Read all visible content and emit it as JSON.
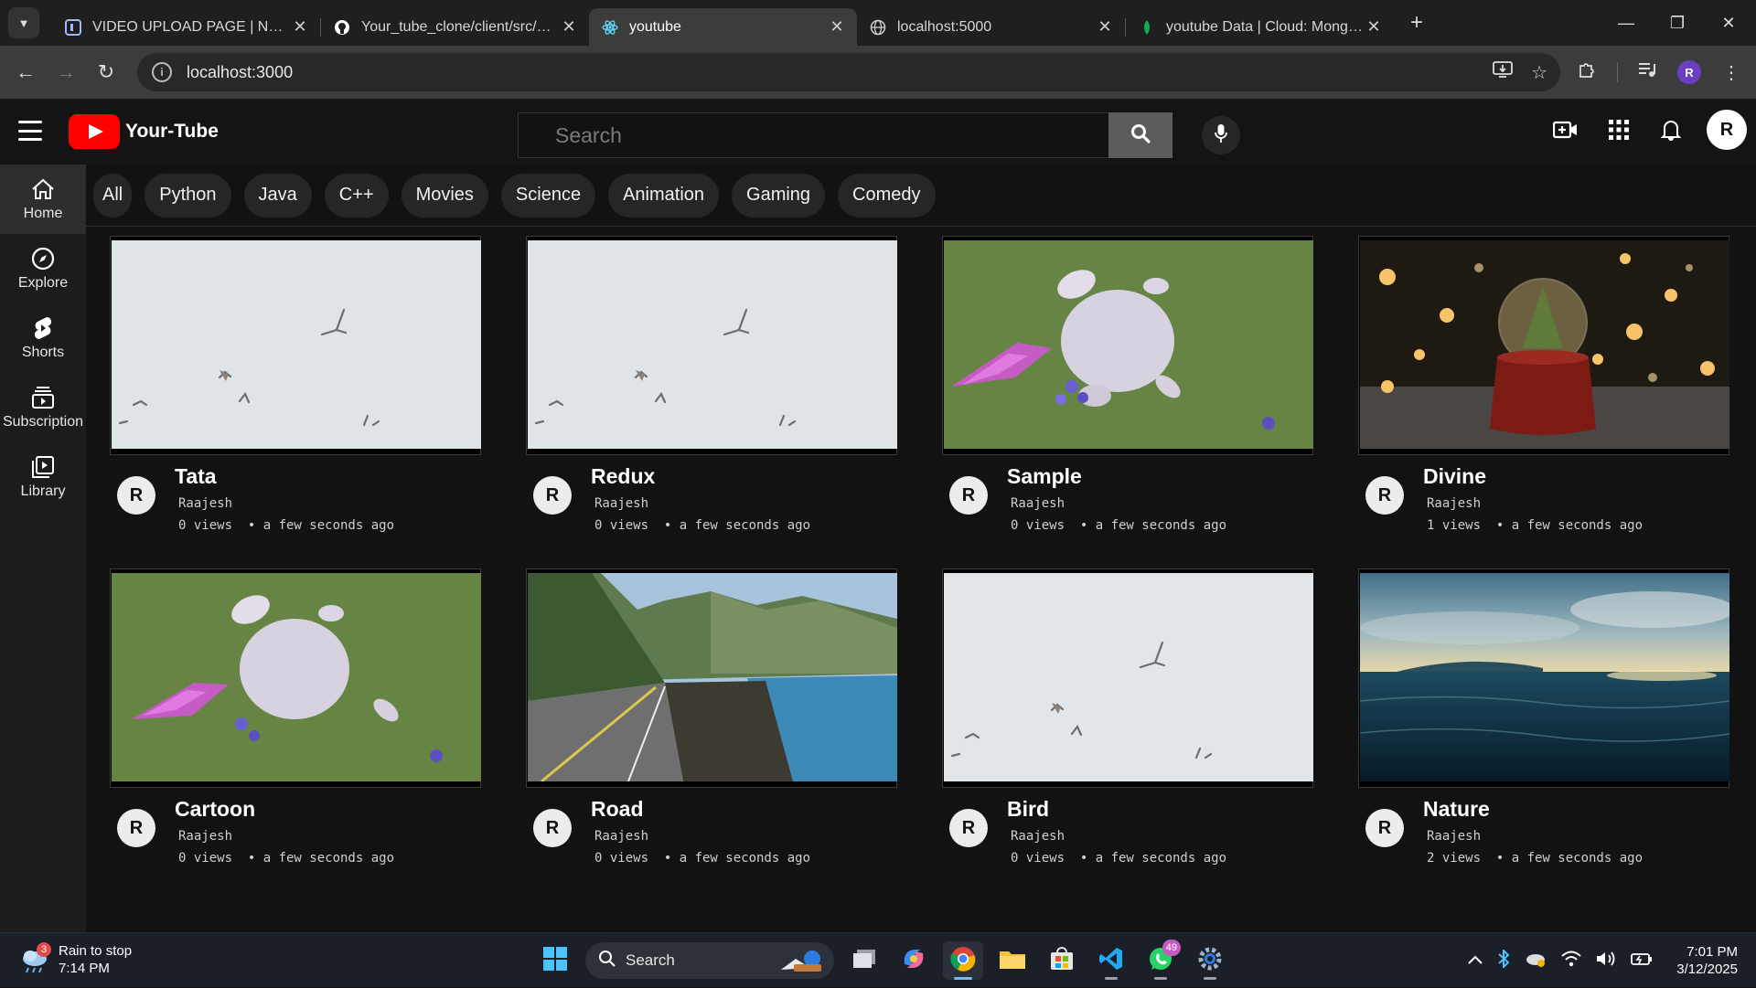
{
  "browser": {
    "tabs": [
      {
        "label": "VIDEO UPLOAD PAGE | NULLCLASS",
        "favicon": "nullclass-icon",
        "active": false
      },
      {
        "label": "Your_tube_clone/client/src/Pages",
        "favicon": "github-icon",
        "active": false
      },
      {
        "label": "youtube",
        "favicon": "react-icon",
        "active": true
      },
      {
        "label": "localhost:5000",
        "favicon": "globe-icon",
        "active": false
      },
      {
        "label": "youtube Data | Cloud: MongoDB",
        "favicon": "mongodb-leaf-icon",
        "active": false
      }
    ],
    "address": "localhost:3000"
  },
  "header": {
    "logo_text": "Your-Tube",
    "search_placeholder": "Search",
    "user_initial": "R"
  },
  "sidebar": {
    "items": [
      {
        "label": "Home",
        "icon": "home-icon",
        "active": true
      },
      {
        "label": "Explore",
        "icon": "compass-icon",
        "active": false
      },
      {
        "label": "Shorts",
        "icon": "shorts-icon",
        "active": false
      },
      {
        "label": "Subscription",
        "icon": "subscriptions-icon",
        "active": false
      },
      {
        "label": "Library",
        "icon": "library-icon",
        "active": false
      }
    ]
  },
  "chips": [
    "All",
    "Python",
    "Java",
    "C++",
    "Movies",
    "Science",
    "Animation",
    "Gaming",
    "Comedy"
  ],
  "videos": [
    {
      "title": "Tata",
      "channel": "Raajesh",
      "avatar": "R",
      "stats": "0 views  • a few seconds ago",
      "thumb": "birds"
    },
    {
      "title": "Redux",
      "channel": "Raajesh",
      "avatar": "R",
      "stats": "0 views  • a few seconds ago",
      "thumb": "birds"
    },
    {
      "title": "Sample",
      "channel": "Raajesh",
      "avatar": "R",
      "stats": "0 views  • a few seconds ago",
      "thumb": "bunny"
    },
    {
      "title": "Divine",
      "channel": "Raajesh",
      "avatar": "R",
      "stats": "1 views  • a few seconds ago",
      "thumb": "snowglobe"
    },
    {
      "title": "Cartoon",
      "channel": "Raajesh",
      "avatar": "R",
      "stats": "0 views  • a few seconds ago",
      "thumb": "bunny"
    },
    {
      "title": "Road",
      "channel": "Raajesh",
      "avatar": "R",
      "stats": "0 views  • a few seconds ago",
      "thumb": "road"
    },
    {
      "title": "Bird",
      "channel": "Raajesh",
      "avatar": "R",
      "stats": "0 views  • a few seconds ago",
      "thumb": "birds"
    },
    {
      "title": "Nature",
      "channel": "Raajesh",
      "avatar": "R",
      "stats": "2 views  • a few seconds ago",
      "thumb": "ocean"
    }
  ],
  "taskbar": {
    "weather_text": "Rain to stop",
    "weather_time": "7:14 PM",
    "weather_badge": "3",
    "search_label": "Search",
    "whatsapp_badge": "49",
    "time": "7:01 PM",
    "date": "3/12/2025"
  },
  "colors": {
    "accent_red": "#ff0000",
    "background": "#121212",
    "sidebar": "#1c1c1c",
    "chip": "#262626"
  }
}
